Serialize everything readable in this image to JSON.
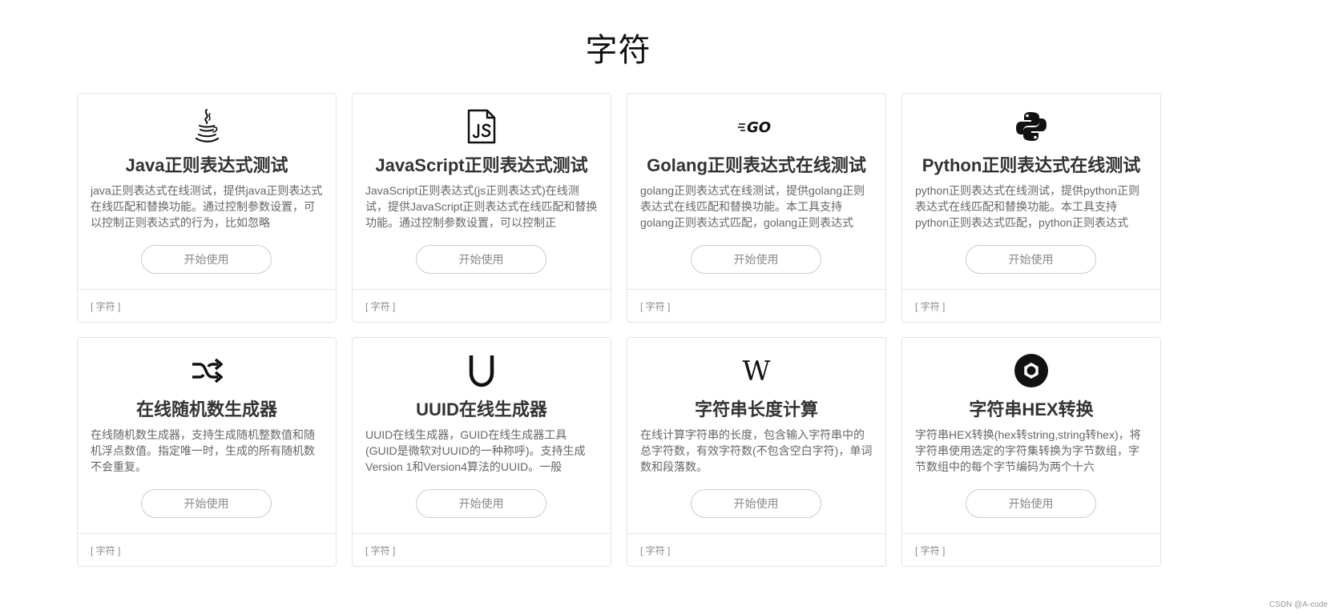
{
  "page": {
    "title": "字符",
    "watermark": "CSDN @A-code"
  },
  "cards": [
    {
      "icon": "java-icon",
      "title": "Java正则表达式测试",
      "description": "java正则表达式在线测试，提供java正则表达式在线匹配和替换功能。通过控制参数设置，可以控制正则表达式的行为，比如忽略",
      "button": "开始使用",
      "tag": "[ 字符 ]"
    },
    {
      "icon": "javascript-icon",
      "title": "JavaScript正则表达式测试",
      "description": "JavaScript正则表达式(js正则表达式)在线测试，提供JavaScript正则表达式在线匹配和替换功能。通过控制参数设置，可以控制正",
      "button": "开始使用",
      "tag": "[ 字符 ]"
    },
    {
      "icon": "golang-icon",
      "title": "Golang正则表达式在线测试",
      "description": "golang正则表达式在线测试，提供golang正则表达式在线匹配和替换功能。本工具支持golang正则表达式匹配，golang正则表达式",
      "button": "开始使用",
      "tag": "[ 字符 ]"
    },
    {
      "icon": "python-icon",
      "title": "Python正则表达式在线测试",
      "description": "python正则表达式在线测试，提供python正则表达式在线匹配和替换功能。本工具支持python正则表达式匹配，python正则表达式",
      "button": "开始使用",
      "tag": "[ 字符 ]"
    },
    {
      "icon": "shuffle-icon",
      "title": "在线随机数生成器",
      "description": "在线随机数生成器，支持生成随机整数值和随机浮点数值。指定唯一时，生成的所有随机数不会重复。",
      "button": "开始使用",
      "tag": "[ 字符 ]"
    },
    {
      "icon": "uuid-icon",
      "title": "UUID在线生成器",
      "description": "UUID在线生成器，GUID在线生成器工具(GUID是微软对UUID的一种称呼)。支持生成Version 1和Version4算法的UUID。一般",
      "button": "开始使用",
      "tag": "[ 字符 ]"
    },
    {
      "icon": "wikipedia-icon",
      "title": "字符串长度计算",
      "description": "在线计算字符串的长度，包含输入字符串中的总字符数，有效字符数(不包含空白字符)，单词数和段落数。",
      "button": "开始使用",
      "tag": "[ 字符 ]"
    },
    {
      "icon": "hex-icon",
      "title": "字符串HEX转换",
      "description": "字符串HEX转换(hex转string,string转hex)，将字符串使用选定的字符集转换为字节数组，字节数组中的每个字节编码为两个十六",
      "button": "开始使用",
      "tag": "[ 字符 ]"
    }
  ]
}
